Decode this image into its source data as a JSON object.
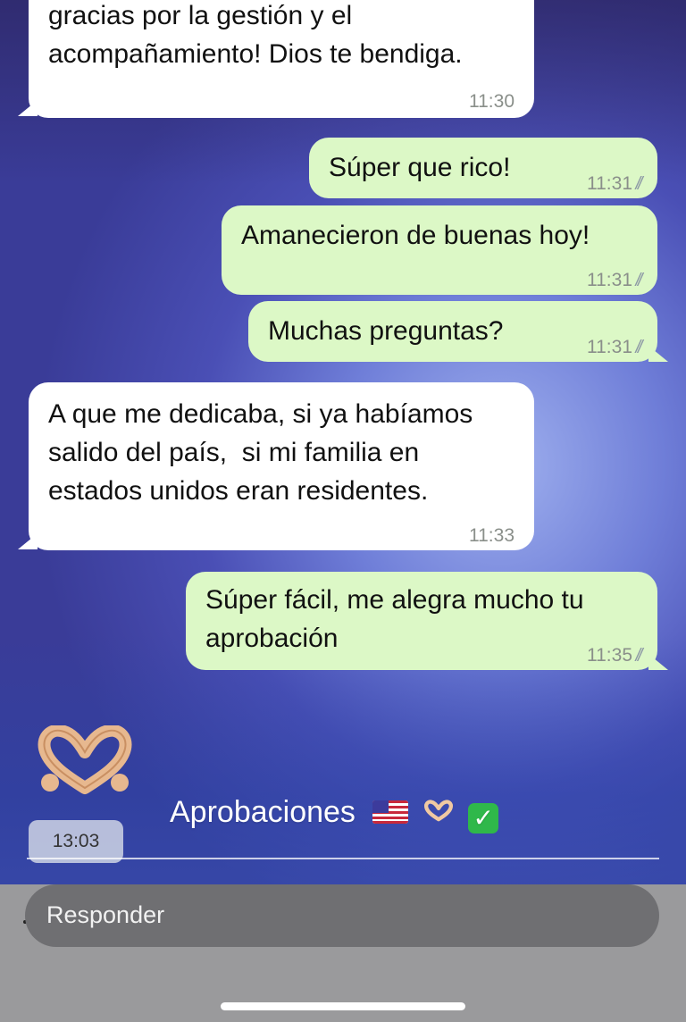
{
  "messages": [
    {
      "dir": "in",
      "text": "gracias por la gestión y el\nacompañamiento! Dios te bendiga.",
      "time": "11:30"
    },
    {
      "dir": "out",
      "text": "Súper que rico!",
      "time": "11:31"
    },
    {
      "dir": "out",
      "text": "Amanecieron de buenas hoy!",
      "time": "11:31"
    },
    {
      "dir": "out",
      "text": "Muchas preguntas?",
      "time": "11:31"
    },
    {
      "dir": "in",
      "text": "A que me dedicaba, si ya habíamos\nsalido del país,  si mi familia en\nestados unidos eran residentes.",
      "time": "11:33"
    },
    {
      "dir": "out",
      "text": "Súper fácil, me alegra mucho tu\naprobación",
      "time": "11:35"
    }
  ],
  "sticker": {
    "icon": "heart-hands-icon",
    "time": "13:03"
  },
  "caption": {
    "text": "Aprobaciones",
    "flag_icon": "us-flag-icon",
    "hands_icon": "heart-hands-icon",
    "check_icon": "check-mark-icon"
  },
  "reply": {
    "placeholder": "Responder"
  },
  "colors": {
    "incoming": "#ffffff",
    "outgoing": "#dcf8c6",
    "ticks": "#8e9aa6"
  }
}
